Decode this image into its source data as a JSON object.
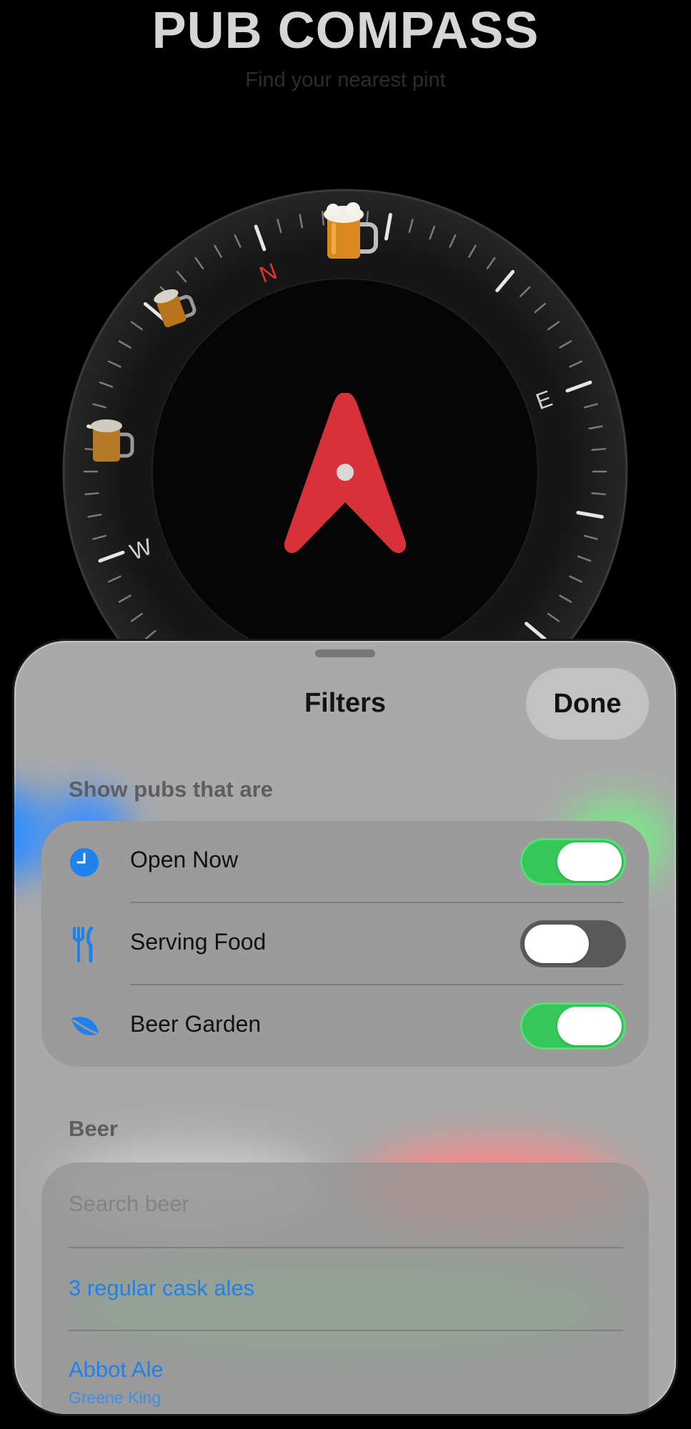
{
  "app": {
    "title": "PUB COMPASS",
    "subtitle": "Find your nearest pint"
  },
  "compass": {
    "cardinals": {
      "n": "N",
      "e": "E",
      "w": "W"
    },
    "pub_markers": [
      "beer-mug-icon",
      "beer-mug-icon",
      "beer-mug-icon"
    ],
    "colors": {
      "needle": "#d7313a",
      "north": "#e0342c"
    }
  },
  "filters": {
    "title": "Filters",
    "done_label": "Done",
    "show_header": "Show pubs that are",
    "options": [
      {
        "label": "Open Now",
        "icon": "clock-icon",
        "enabled": true
      },
      {
        "label": "Serving Food",
        "icon": "fork-knife-icon",
        "enabled": false
      },
      {
        "label": "Beer Garden",
        "icon": "leaf-icon",
        "enabled": true
      }
    ],
    "beer_header": "Beer",
    "search_placeholder": "Search beer",
    "cask_ales_link": "3 regular cask ales",
    "beers": [
      {
        "name": "Abbot Ale",
        "brewery": "Greene King"
      }
    ]
  },
  "colors": {
    "accent": "#1e82ea",
    "toggle_on": "#35c759"
  }
}
